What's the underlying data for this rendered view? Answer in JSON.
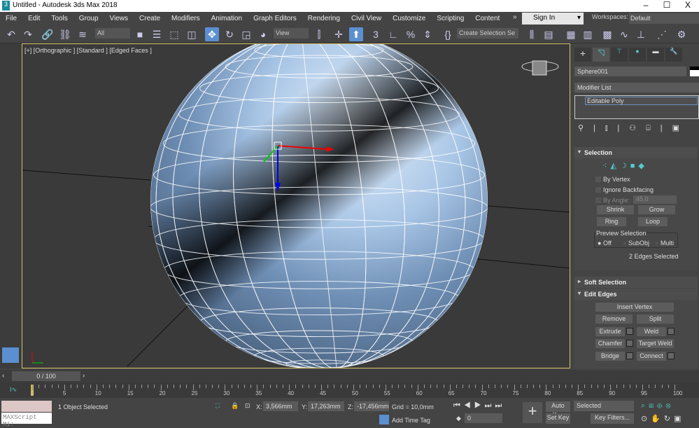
{
  "window": {
    "title": "Untitled - Autodesk 3ds Max 2018",
    "minimize": "–",
    "maximize": "☐",
    "close": "X"
  },
  "menu": [
    "File",
    "Edit",
    "Tools",
    "Group",
    "Views",
    "Create",
    "Modifiers",
    "Animation",
    "Graph Editors",
    "Rendering",
    "Civil View",
    "Customize",
    "Scripting",
    "Content"
  ],
  "menu_more": "»",
  "signin": "Sign In",
  "workspaces": {
    "label": "Workspaces:",
    "value": "Default"
  },
  "toolbar": {
    "filter": "All",
    "ref_coord": "View",
    "named_sel": "Create Selection Se"
  },
  "viewport": {
    "label": "[+] [Orthographic ] [Standard ] [Edged Faces ]",
    "accent": "#d8c36a"
  },
  "command_panel": {
    "object_name": "Sphere001",
    "modifier_list": "Modifier List",
    "stack_item": "Editable Poly",
    "selection": {
      "title": "Selection",
      "by_vertex": "By Vertex",
      "ignore_backfacing": "Ignore Backfacing",
      "by_angle": "By Angle:",
      "angle_value": "45,0",
      "shrink": "Shrink",
      "grow": "Grow",
      "ring": "Ring",
      "loop": "Loop",
      "preview": "Preview Selection",
      "off": "Off",
      "subobj": "SubObj",
      "multi": "Multi",
      "status": "2 Edges Selected"
    },
    "soft_selection": "Soft Selection",
    "edit_edges": {
      "title": "Edit Edges",
      "insert_vertex": "Insert Vertex",
      "remove": "Remove",
      "split": "Split",
      "extrude": "Extrude",
      "weld": "Weld",
      "chamfer": "Chamfer",
      "target_weld": "Target Weld",
      "bridge": "Bridge",
      "connect": "Connect"
    }
  },
  "timeline": {
    "frame": "0 / 100",
    "ticks": [
      "0",
      "5",
      "10",
      "15",
      "20",
      "25",
      "30",
      "35",
      "40",
      "45",
      "50",
      "55",
      "60",
      "65",
      "70",
      "75",
      "80",
      "85",
      "90",
      "95",
      "100"
    ]
  },
  "status": {
    "maxscript": "MAXScript Mi:",
    "selected": "1 Object Selected",
    "x_label": "X:",
    "x": "3,566mm",
    "y_label": "Y:",
    "y": "17,263mm",
    "z_label": "Z:",
    "z": "-17,456mm",
    "grid": "Grid = 10,0mm",
    "add_time_tag": "Add Time Tag",
    "frame_field": "0",
    "auto_key": "Auto Key",
    "set_key": "Set Key",
    "key_mode": "Selected",
    "key_filters": "Key Filters..."
  }
}
